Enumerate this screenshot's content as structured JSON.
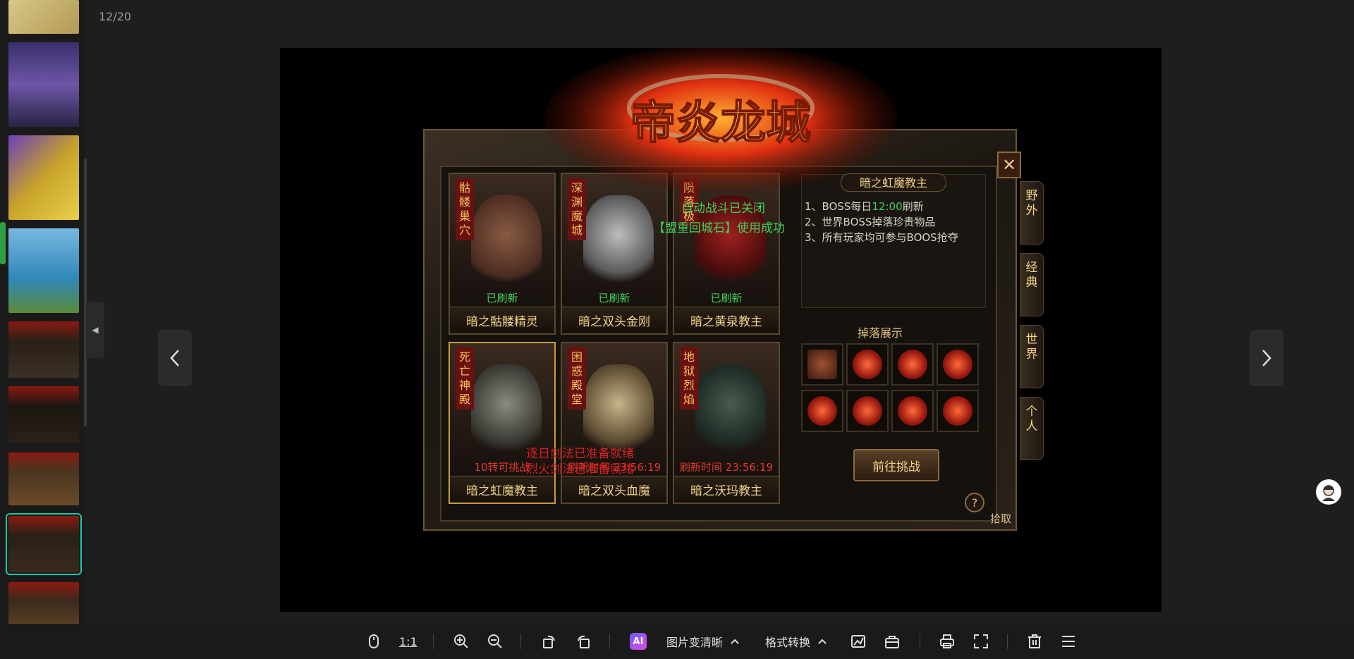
{
  "counter": "12/20",
  "toolbar": {
    "zoom_ratio": "1:1",
    "ai_label": "AI",
    "enhance_label": "图片变清晰",
    "convert_label": "格式转换"
  },
  "game": {
    "logo_text": "帝炎龙城",
    "close_glyph": "✕",
    "cards": [
      {
        "vlabel": "骷\n髅\n巢\n穴",
        "status": "已刷新",
        "name": "暗之骷髅精灵"
      },
      {
        "vlabel": "深\n渊\n魔\n城",
        "status": "已刷新",
        "name": "暗之双头金刚"
      },
      {
        "vlabel": "陨\n落\n极",
        "status": "已刷新",
        "name": "暗之黄泉教主"
      },
      {
        "vlabel": "死\n亡\n神\n殿",
        "status": "10转可挑战",
        "name": "暗之虹魔教主"
      },
      {
        "vlabel": "困\n惑\n殿\n堂",
        "status": "刷新时间 23:56:19",
        "name": "暗之双头血魔"
      },
      {
        "vlabel": "地\n狱\n烈\n焰",
        "status": "刷新时间 23:56:19",
        "name": "暗之沃玛教主"
      }
    ],
    "info_title": "暗之虹魔教主",
    "rules": {
      "r1_prefix": "1、BOSS每日",
      "r1_time": "12:00",
      "r1_suffix": "刷新",
      "r2": "2、世界BOSS掉落珍贵物品",
      "r3": "3、所有玩家均可参与BOOS抢夺"
    },
    "drop_title": "掉落展示",
    "challenge_button": "前往挑战",
    "help_glyph": "?",
    "tabs": [
      "野\n外",
      "经\n典",
      "世\n界",
      "个\n人"
    ],
    "pickup": "拾取",
    "messages": {
      "auto_off": "自动战斗已关闭",
      "stone_used": "【盟重回城石】使用成功",
      "sword1": "逐日剑法已准备就绪",
      "sword2": "烈火剑法已准备就绪"
    }
  }
}
